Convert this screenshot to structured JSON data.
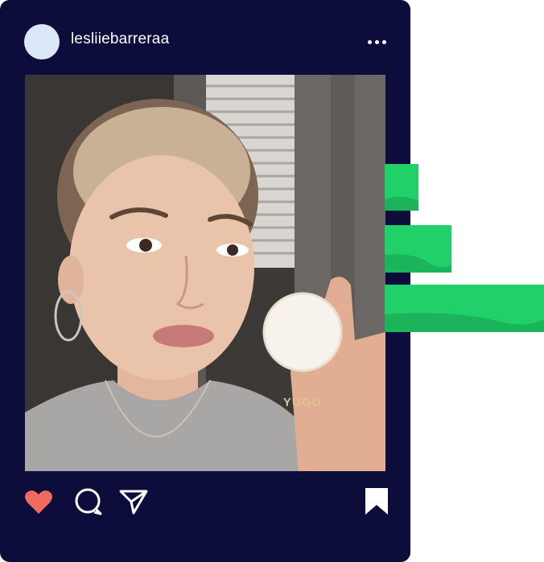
{
  "post": {
    "username": "lesliiebarreraa",
    "product_label": "YUGO"
  },
  "icons": {
    "more": "more-horizontal-icon",
    "like": "heart-icon",
    "comment": "comment-icon",
    "share": "send-icon",
    "save": "bookmark-icon"
  },
  "colors": {
    "card_background": "#0c0d3a",
    "avatar": "#dbe6f7",
    "like": "#f06a5f",
    "accent_green": "#22d06a",
    "accent_green_dark": "#1bb45a"
  }
}
